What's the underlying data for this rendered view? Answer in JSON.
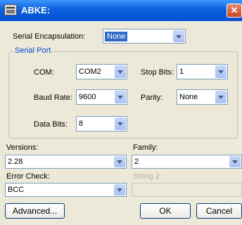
{
  "window": {
    "title": "ABKE:",
    "close_glyph": "✕"
  },
  "serial_encapsulation": {
    "label": "Serial Encapsulation:",
    "value": "None"
  },
  "serial_port": {
    "group_label": "Serial Port",
    "com": {
      "label": "COM:",
      "value": "COM2"
    },
    "baud_rate": {
      "label": "Baud Rate:",
      "value": "9600"
    },
    "data_bits": {
      "label": "Data Bits:",
      "value": "8"
    },
    "stop_bits": {
      "label": "Stop Bits:",
      "value": "1"
    },
    "parity": {
      "label": "Parity:",
      "value": "None"
    }
  },
  "versions": {
    "label": "Versions:",
    "value": "2.28"
  },
  "family": {
    "label": "Family:",
    "value": "2"
  },
  "error_check": {
    "label": "Error Check:",
    "value": "BCC"
  },
  "string2": {
    "label": "String 2:",
    "value": ""
  },
  "buttons": {
    "advanced": "Advanced...",
    "ok": "OK",
    "cancel": "Cancel"
  }
}
